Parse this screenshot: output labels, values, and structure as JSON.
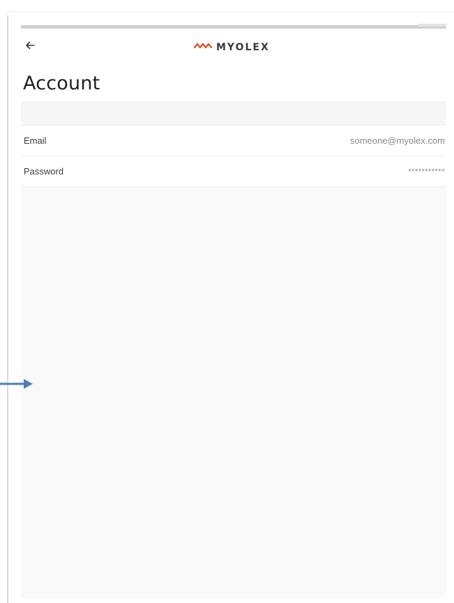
{
  "header": {
    "back_icon": "arrow-left-icon",
    "logo_icon": "myolex-wave-icon",
    "logo_text": "MYOLEX",
    "logo_color": "#e8502a"
  },
  "page": {
    "title": "Account"
  },
  "account": {
    "rows": [
      {
        "label": "Email",
        "value": "someone@myolex.com"
      },
      {
        "label": "Password",
        "value": "***********"
      }
    ]
  },
  "annotation": {
    "icon": "arrow-right-icon",
    "color": "#4a7ebb"
  }
}
